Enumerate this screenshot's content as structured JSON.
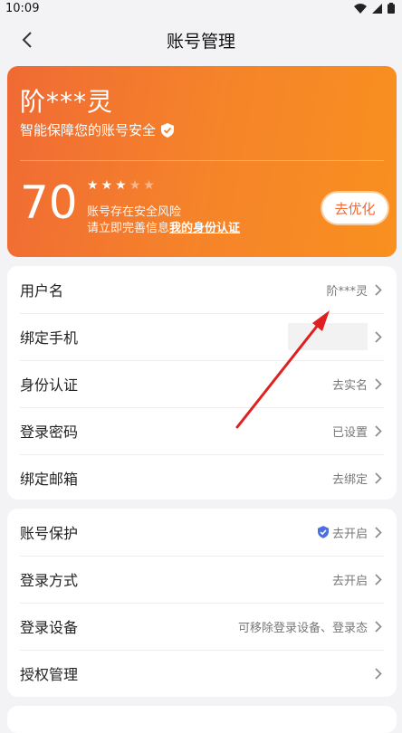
{
  "status": {
    "time": "10:09"
  },
  "nav": {
    "title": "账号管理"
  },
  "hero": {
    "name": "阶***灵",
    "subtitle": "智能保障您的账号安全",
    "score": "70",
    "stars_filled": 3,
    "stars_total": 5,
    "risk_line1": "账号存在安全风险",
    "risk_line2_prefix": "请立即完善信息",
    "risk_link": "我的身份认证",
    "button": "去优化",
    "colors": {
      "gradient_start": "#f06a34",
      "gradient_end": "#f9901f"
    }
  },
  "group1": [
    {
      "label": "用户名",
      "value": "阶***灵"
    },
    {
      "label": "绑定手机",
      "value": ""
    },
    {
      "label": "身份认证",
      "value": "去实名"
    },
    {
      "label": "登录密码",
      "value": "已设置"
    },
    {
      "label": "绑定邮箱",
      "value": "去绑定"
    }
  ],
  "group2": [
    {
      "label": "账号保护",
      "value": "去开启",
      "icon": "shield-check-icon"
    },
    {
      "label": "登录方式",
      "value": "去开启"
    },
    {
      "label": "登录设备",
      "value": "可移除登录设备、登录态"
    },
    {
      "label": "授权管理",
      "value": ""
    }
  ],
  "annotation": {
    "color": "#e02020"
  }
}
